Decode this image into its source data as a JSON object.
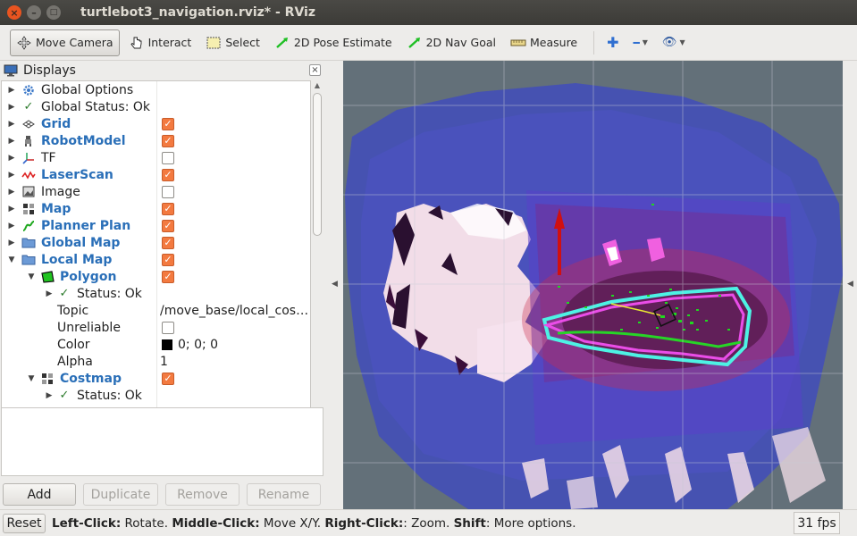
{
  "window": {
    "title": "turtlebot3_navigation.rviz* - RViz",
    "close_glyph": "×",
    "minimize_glyph": "–",
    "maximize_glyph": "□"
  },
  "toolbar": {
    "move_camera": "Move Camera",
    "interact": "Interact",
    "select": "Select",
    "pose_estimate": "2D Pose Estimate",
    "nav_goal": "2D Nav Goal",
    "measure": "Measure",
    "add_glyph": "✚",
    "remove_glyph": "━",
    "view_glyph": "👁",
    "dropdown_glyph": "▼"
  },
  "displays": {
    "title": "Displays",
    "close_glyph": "×",
    "rows": [
      {
        "label": "Global Options",
        "arrow": "▶",
        "bold": false
      },
      {
        "label": "Global Status: Ok",
        "arrow": "▶",
        "bold": false
      },
      {
        "label": "Grid",
        "arrow": "▶",
        "bold": true,
        "checked": true
      },
      {
        "label": "RobotModel",
        "arrow": "▶",
        "bold": true,
        "checked": true
      },
      {
        "label": "TF",
        "arrow": "▶",
        "bold": false,
        "checked": false
      },
      {
        "label": "LaserScan",
        "arrow": "▶",
        "bold": true,
        "checked": true
      },
      {
        "label": "Image",
        "arrow": "▶",
        "bold": false,
        "checked": false
      },
      {
        "label": "Map",
        "arrow": "▶",
        "bold": true,
        "checked": true
      },
      {
        "label": "Planner Plan",
        "arrow": "▶",
        "bold": true,
        "checked": true
      },
      {
        "label": "Global Map",
        "arrow": "▶",
        "bold": true,
        "checked": true
      },
      {
        "label": "Local Map",
        "arrow": "▼",
        "bold": true,
        "checked": true
      },
      {
        "label": "Polygon",
        "arrow": "▼",
        "bold": true,
        "checked": true
      },
      {
        "label": "Status: Ok",
        "arrow": "▶",
        "bold": false
      },
      {
        "label": "Topic",
        "value": "/move_base/local_cos…"
      },
      {
        "label": "Unreliable",
        "checked": false
      },
      {
        "label": "Color",
        "value": "0; 0; 0",
        "swatch": "#000000"
      },
      {
        "label": "Alpha",
        "value": "1"
      },
      {
        "label": "Costmap",
        "arrow": "▼",
        "bold": true,
        "checked": true
      },
      {
        "label": "Status: Ok",
        "arrow": "▶",
        "bold": false
      }
    ]
  },
  "buttons": {
    "add": "Add",
    "duplicate": "Duplicate",
    "remove": "Remove",
    "rename": "Rename"
  },
  "status": {
    "reset": "Reset",
    "hint_left_key": "Left-Click:",
    "hint_left_val": " Rotate. ",
    "hint_middle_key": "Middle-Click:",
    "hint_middle_val": " Move X/Y. ",
    "hint_right_key": "Right-Click:",
    "hint_right_val": ": Zoom. ",
    "hint_shift_key": "Shift",
    "hint_shift_val": ": More options.",
    "fps": "31 fps"
  },
  "colors": {
    "accent_orange": "#e95420",
    "checkbox_orange": "#f37a40",
    "display_blue": "#2a6fb8",
    "status_green": "#2b7a2b",
    "viewport_bg": "#64717b"
  }
}
